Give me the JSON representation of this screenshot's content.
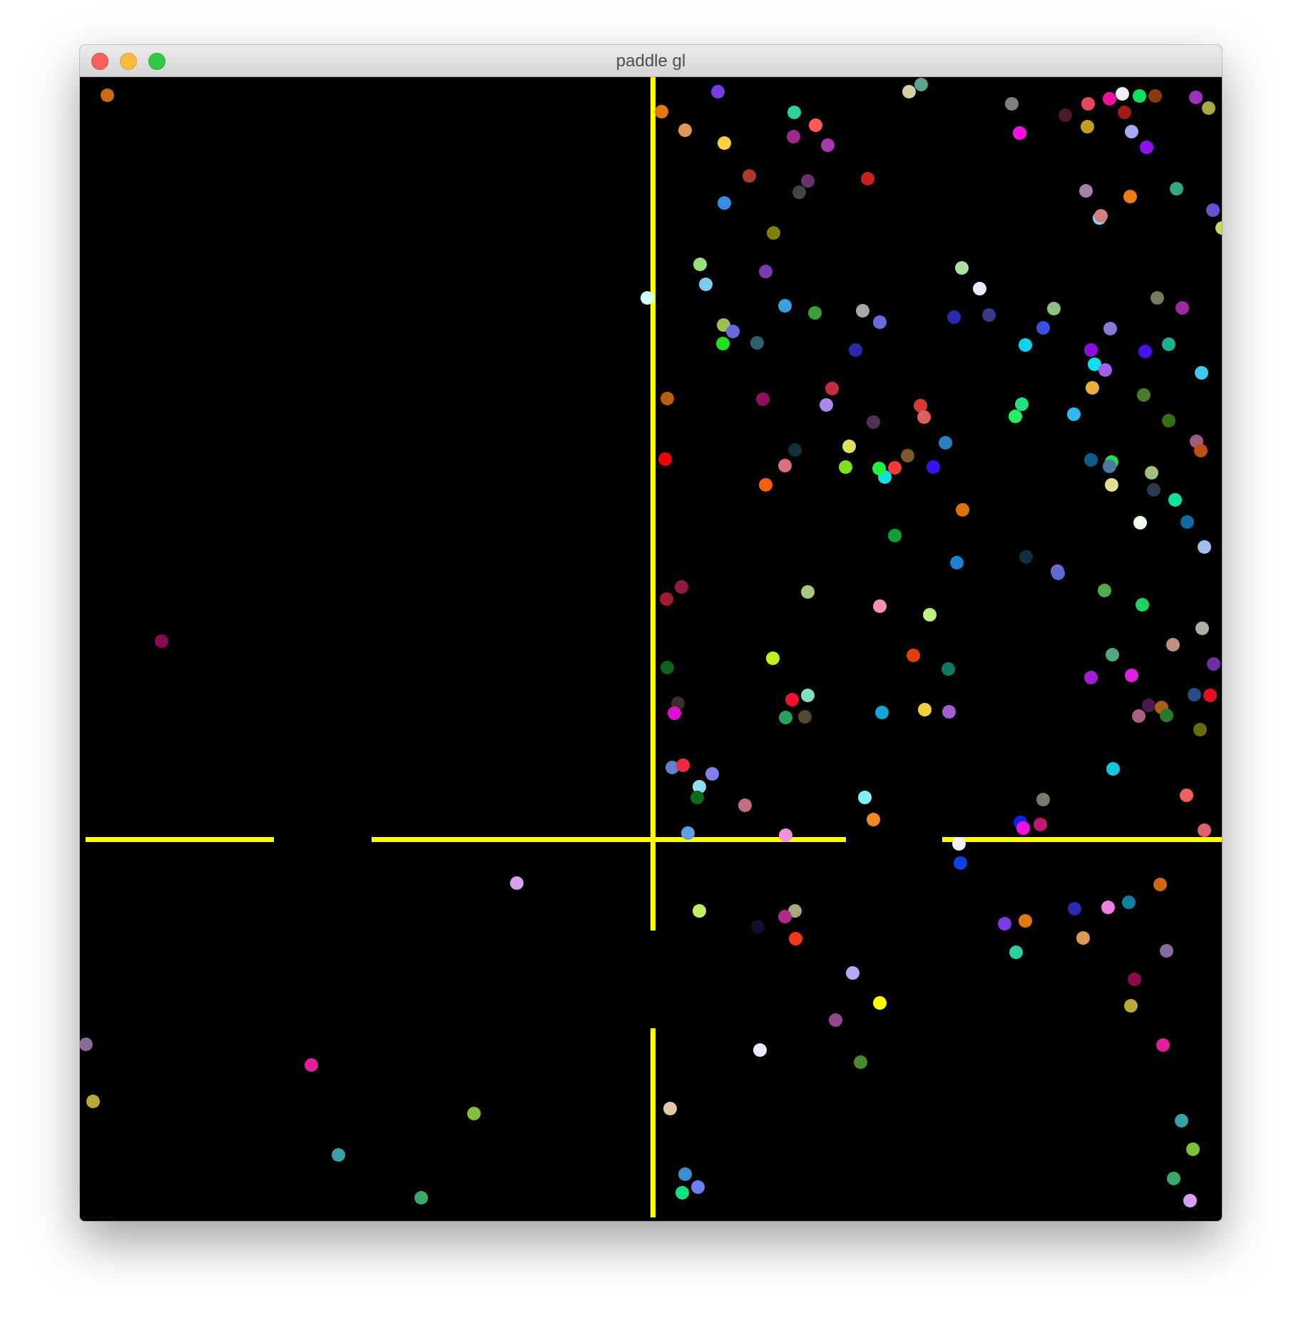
{
  "window": {
    "title": "paddle gl",
    "buttons": {
      "close_color": "#fc605c",
      "minimize_color": "#fdbc40",
      "maximize_color": "#34c84a"
    }
  },
  "scene": {
    "background_color": "#000000",
    "paddle_color": "#ffff00",
    "walls": [
      "vertical-upper",
      "vertical-lower",
      "horizontal-left",
      "horizontal-middle",
      "horizontal-right"
    ],
    "ball_colors": [
      "#cc6a10",
      "#8a0a4f",
      "#8a6a9a",
      "#b8aa38",
      "#e0209a",
      "#3aa0a8",
      "#7fbf3a",
      "#3aa86a",
      "#d8a0f0",
      "#e07a10",
      "#e09a58",
      "#7a3ae8",
      "#2ad0a0",
      "#fe5a5a",
      "#ffd040",
      "#a02a8a",
      "#a83ab0",
      "#ab3a2a",
      "#6a3070",
      "#3a8ae8",
      "#444444",
      "#c82020",
      "#808000",
      "#9ae07a",
      "#80c8f0",
      "#3aa0e0",
      "#7a3ab0",
      "#d0fefe",
      "#a0c050",
      "#6a6ae0",
      "#20e020",
      "#2a6070",
      "#3aa03a",
      "#a8a8a8",
      "#6a6ad8",
      "#2a2aa8",
      "#c03040",
      "#b86010",
      "#901060",
      "#a888e8",
      "#50305a",
      "#10303a",
      "#dce060",
      "#d87080",
      "#80e020",
      "#10e0e0",
      "#d83a3a",
      "#e06060",
      "#2a80c0",
      "#7a5a2a",
      "#f06010",
      "#f00000",
      "#f03a3a",
      "#20f040",
      "#3a10f0",
      "#e07010",
      "#10a030",
      "#901a40",
      "#a8c880",
      "#f890b0",
      "#c0f080",
      "#2080d0",
      "#e04010",
      "#107a60",
      "#106020",
      "#402a2a",
      "#e010d0",
      "#f01030",
      "#80e0c0",
      "#504a30",
      "#2aa060",
      "#10a8d0",
      "#f0d040",
      "#a060d0",
      "#6080d0",
      "#f02a40",
      "#8080f0",
      "#90e0f0",
      "#106a20",
      "#c07080",
      "#80f0f0",
      "#f08a20",
      "#60a0e0",
      "#f090e0",
      "#a01a2a",
      "#c0f020",
      "#1040e0",
      "#f0f0fe",
      "#c0f060",
      "#a8a880",
      "#10102a",
      "#f03a20",
      "#b02a8a",
      "#b8a8f8",
      "#ffff00",
      "#904a8a",
      "#e8e8fe",
      "#4a8a2a",
      "#e0c8a8",
      "#3a90d0",
      "#6a80f0",
      "#10e080",
      "#d0d0a0",
      "#60a090",
      "#808080",
      "#e04a5a",
      "#4a1a2a",
      "#f010a0",
      "#f0f0f0",
      "#10e060",
      "#8a3a10",
      "#a030c0",
      "#a8a840",
      "#ff10e0",
      "#a8a8f8",
      "#a01a1a",
      "#c0a020",
      "#9010f0",
      "#30a880",
      "#a880a8",
      "#f07a1a",
      "#90d0f0",
      "#d08080",
      "#6a50d0",
      "#c8d860",
      "#b0e0a0",
      "#f0e8ff",
      "#2a2ab0",
      "#3a3a8a",
      "#90c080",
      "#7a7a5a",
      "#9a2aa0",
      "#10d0f0",
      "#3a50e0",
      "#8a7ad8",
      "#20b090",
      "#8a10e0",
      "#4a10f0",
      "#10e0f0",
      "#a060f0",
      "#e8b040",
      "#40c8f0",
      "#20e080",
      "#20f060",
      "#4a7a2a",
      "#307010",
      "#30b8f0",
      "#a05a80",
      "#105a8a",
      "#a0c080",
      "#c05010",
      "#20e050",
      "#4a7aa0",
      "#e0e090",
      "#2a3a4a",
      "#10e0a0",
      "#f0fef0",
      "#106aa0",
      "#a0c0f0",
      "#103040",
      "#9a5ae0",
      "#5a6ad0",
      "#50a850",
      "#20d060",
      "#c09080",
      "#b0b0a0",
      "#50a880",
      "#e020e0",
      "#6a30a0",
      "#a020d0",
      "#4a1a4a",
      "#2a4a8a",
      "#a8601a",
      "#a86080",
      "#2a7a2a",
      "#e01020",
      "#6a6a10",
      "#10c8e0",
      "#f06060",
      "#7a7a6a",
      "#c01a70",
      "#1020f0",
      "#f010e0",
      "#e06070",
      "#2a2ab0",
      "#f080e0",
      "#1080a0"
    ]
  }
}
